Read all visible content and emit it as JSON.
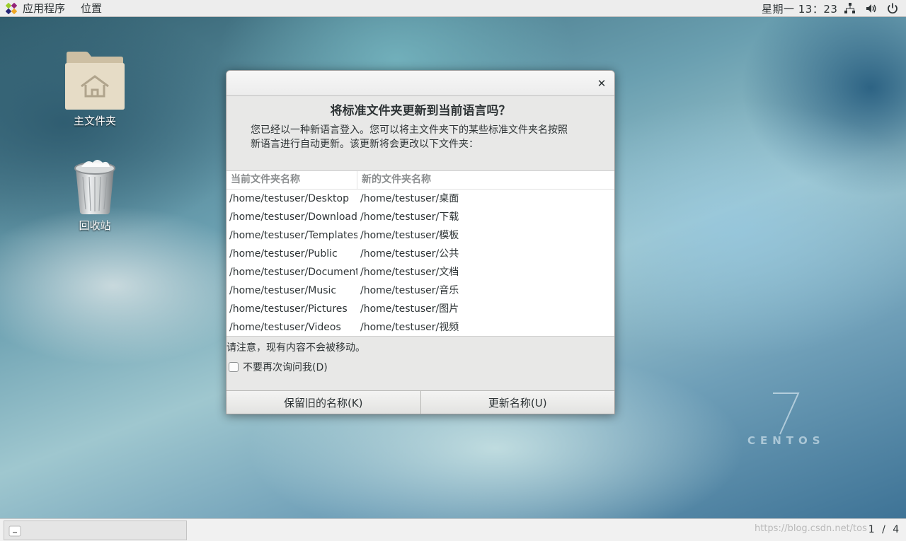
{
  "top_panel": {
    "applications_label": "应用程序",
    "places_label": "位置",
    "clock": "星期一 13：23",
    "tray_icons": [
      "network-icon",
      "volume-icon",
      "power-icon"
    ]
  },
  "desktop": {
    "icons": [
      {
        "label": "主文件夹",
        "icon": "home-folder-icon"
      },
      {
        "label": "回收站",
        "icon": "trash-icon"
      }
    ],
    "branding": {
      "number": "7",
      "word": "CENTOS"
    }
  },
  "dialog": {
    "heading": "将标准文件夹更新到当前语言吗？",
    "body_line1": "您已经以一种新语言登入。您可以将主文件夹下的某些标准文件夹名按照",
    "body_line2": "新语言进行自动更新。该更新将会更改以下文件夹：",
    "columns": [
      "当前文件夹名称",
      "新的文件夹名称"
    ],
    "rows": [
      [
        "/home/testuser/Desktop",
        "/home/testuser/桌面"
      ],
      [
        "/home/testuser/Downloads",
        "/home/testuser/下载"
      ],
      [
        "/home/testuser/Templates",
        "/home/testuser/模板"
      ],
      [
        "/home/testuser/Public",
        "/home/testuser/公共"
      ],
      [
        "/home/testuser/Documents",
        "/home/testuser/文档"
      ],
      [
        "/home/testuser/Music",
        "/home/testuser/音乐"
      ],
      [
        "/home/testuser/Pictures",
        "/home/testuser/图片"
      ],
      [
        "/home/testuser/Videos",
        "/home/testuser/视频"
      ]
    ],
    "note": "请注意，现有内容不会被移动。",
    "dont_ask_label": "不要再次询问我(D)",
    "dont_ask_checked": false,
    "keep_button": "保留旧的名称(K)",
    "update_button": "更新名称(U)",
    "close_glyph": "✕"
  },
  "bottom_panel": {
    "watermark": "https://blog.csdn.net/tos",
    "workspace": "1 / 4"
  }
}
